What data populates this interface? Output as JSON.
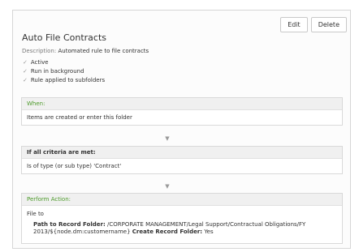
{
  "header": {
    "title": "Auto File Contracts",
    "edit_label": "Edit",
    "delete_label": "Delete"
  },
  "description": {
    "label": "Description:",
    "text": "Automated rule to file contracts"
  },
  "flags": [
    {
      "icon": "check-icon",
      "label": "Active"
    },
    {
      "icon": "check-icon",
      "label": "Run in background"
    },
    {
      "icon": "check-icon",
      "label": "Rule applied to subfolders"
    }
  ],
  "sections": {
    "when": {
      "heading": "When:",
      "text": "Items are created or enter this folder"
    },
    "criteria": {
      "heading": "If all criteria are met:",
      "text": "Is of type (or sub type) 'Contract'"
    },
    "action": {
      "heading": "Perform Action:",
      "action_name": "File to",
      "path_label": "Path to Record Folder:",
      "path_value_line1": "/CORPORATE MANAGEMENT/Legal Support/Contractual Obligations/FY",
      "path_value_line2": "2013/${node.dm:customername}",
      "create_label": "Create Record Folder:",
      "create_value": "Yes"
    }
  },
  "colors": {
    "accent_green": "#4c9a2a",
    "panel_border": "#d6d6d6",
    "section_header_bg": "#f0f0f0"
  }
}
